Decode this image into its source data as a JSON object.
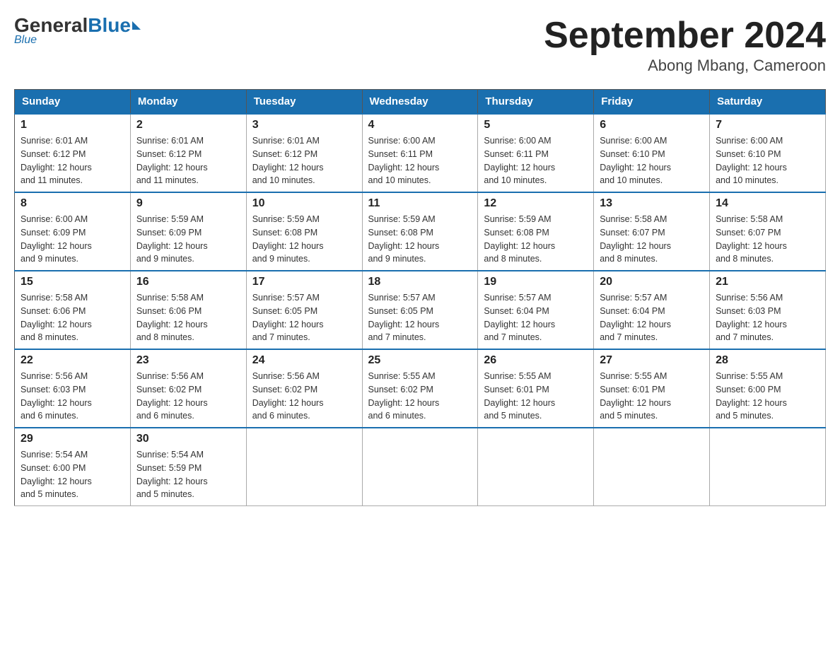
{
  "header": {
    "logo_general": "General",
    "logo_blue": "Blue",
    "month_title": "September 2024",
    "subtitle": "Abong Mbang, Cameroon"
  },
  "days_of_week": [
    "Sunday",
    "Monday",
    "Tuesday",
    "Wednesday",
    "Thursday",
    "Friday",
    "Saturday"
  ],
  "weeks": [
    [
      {
        "day": "1",
        "sunrise": "6:01 AM",
        "sunset": "6:12 PM",
        "daylight": "12 hours and 11 minutes."
      },
      {
        "day": "2",
        "sunrise": "6:01 AM",
        "sunset": "6:12 PM",
        "daylight": "12 hours and 11 minutes."
      },
      {
        "day": "3",
        "sunrise": "6:01 AM",
        "sunset": "6:12 PM",
        "daylight": "12 hours and 10 minutes."
      },
      {
        "day": "4",
        "sunrise": "6:00 AM",
        "sunset": "6:11 PM",
        "daylight": "12 hours and 10 minutes."
      },
      {
        "day": "5",
        "sunrise": "6:00 AM",
        "sunset": "6:11 PM",
        "daylight": "12 hours and 10 minutes."
      },
      {
        "day": "6",
        "sunrise": "6:00 AM",
        "sunset": "6:10 PM",
        "daylight": "12 hours and 10 minutes."
      },
      {
        "day": "7",
        "sunrise": "6:00 AM",
        "sunset": "6:10 PM",
        "daylight": "12 hours and 10 minutes."
      }
    ],
    [
      {
        "day": "8",
        "sunrise": "6:00 AM",
        "sunset": "6:09 PM",
        "daylight": "12 hours and 9 minutes."
      },
      {
        "day": "9",
        "sunrise": "5:59 AM",
        "sunset": "6:09 PM",
        "daylight": "12 hours and 9 minutes."
      },
      {
        "day": "10",
        "sunrise": "5:59 AM",
        "sunset": "6:08 PM",
        "daylight": "12 hours and 9 minutes."
      },
      {
        "day": "11",
        "sunrise": "5:59 AM",
        "sunset": "6:08 PM",
        "daylight": "12 hours and 9 minutes."
      },
      {
        "day": "12",
        "sunrise": "5:59 AM",
        "sunset": "6:08 PM",
        "daylight": "12 hours and 8 minutes."
      },
      {
        "day": "13",
        "sunrise": "5:58 AM",
        "sunset": "6:07 PM",
        "daylight": "12 hours and 8 minutes."
      },
      {
        "day": "14",
        "sunrise": "5:58 AM",
        "sunset": "6:07 PM",
        "daylight": "12 hours and 8 minutes."
      }
    ],
    [
      {
        "day": "15",
        "sunrise": "5:58 AM",
        "sunset": "6:06 PM",
        "daylight": "12 hours and 8 minutes."
      },
      {
        "day": "16",
        "sunrise": "5:58 AM",
        "sunset": "6:06 PM",
        "daylight": "12 hours and 8 minutes."
      },
      {
        "day": "17",
        "sunrise": "5:57 AM",
        "sunset": "6:05 PM",
        "daylight": "12 hours and 7 minutes."
      },
      {
        "day": "18",
        "sunrise": "5:57 AM",
        "sunset": "6:05 PM",
        "daylight": "12 hours and 7 minutes."
      },
      {
        "day": "19",
        "sunrise": "5:57 AM",
        "sunset": "6:04 PM",
        "daylight": "12 hours and 7 minutes."
      },
      {
        "day": "20",
        "sunrise": "5:57 AM",
        "sunset": "6:04 PM",
        "daylight": "12 hours and 7 minutes."
      },
      {
        "day": "21",
        "sunrise": "5:56 AM",
        "sunset": "6:03 PM",
        "daylight": "12 hours and 7 minutes."
      }
    ],
    [
      {
        "day": "22",
        "sunrise": "5:56 AM",
        "sunset": "6:03 PM",
        "daylight": "12 hours and 6 minutes."
      },
      {
        "day": "23",
        "sunrise": "5:56 AM",
        "sunset": "6:02 PM",
        "daylight": "12 hours and 6 minutes."
      },
      {
        "day": "24",
        "sunrise": "5:56 AM",
        "sunset": "6:02 PM",
        "daylight": "12 hours and 6 minutes."
      },
      {
        "day": "25",
        "sunrise": "5:55 AM",
        "sunset": "6:02 PM",
        "daylight": "12 hours and 6 minutes."
      },
      {
        "day": "26",
        "sunrise": "5:55 AM",
        "sunset": "6:01 PM",
        "daylight": "12 hours and 5 minutes."
      },
      {
        "day": "27",
        "sunrise": "5:55 AM",
        "sunset": "6:01 PM",
        "daylight": "12 hours and 5 minutes."
      },
      {
        "day": "28",
        "sunrise": "5:55 AM",
        "sunset": "6:00 PM",
        "daylight": "12 hours and 5 minutes."
      }
    ],
    [
      {
        "day": "29",
        "sunrise": "5:54 AM",
        "sunset": "6:00 PM",
        "daylight": "12 hours and 5 minutes."
      },
      {
        "day": "30",
        "sunrise": "5:54 AM",
        "sunset": "5:59 PM",
        "daylight": "12 hours and 5 minutes."
      },
      null,
      null,
      null,
      null,
      null
    ]
  ],
  "labels": {
    "sunrise": "Sunrise:",
    "sunset": "Sunset:",
    "daylight": "Daylight:"
  }
}
